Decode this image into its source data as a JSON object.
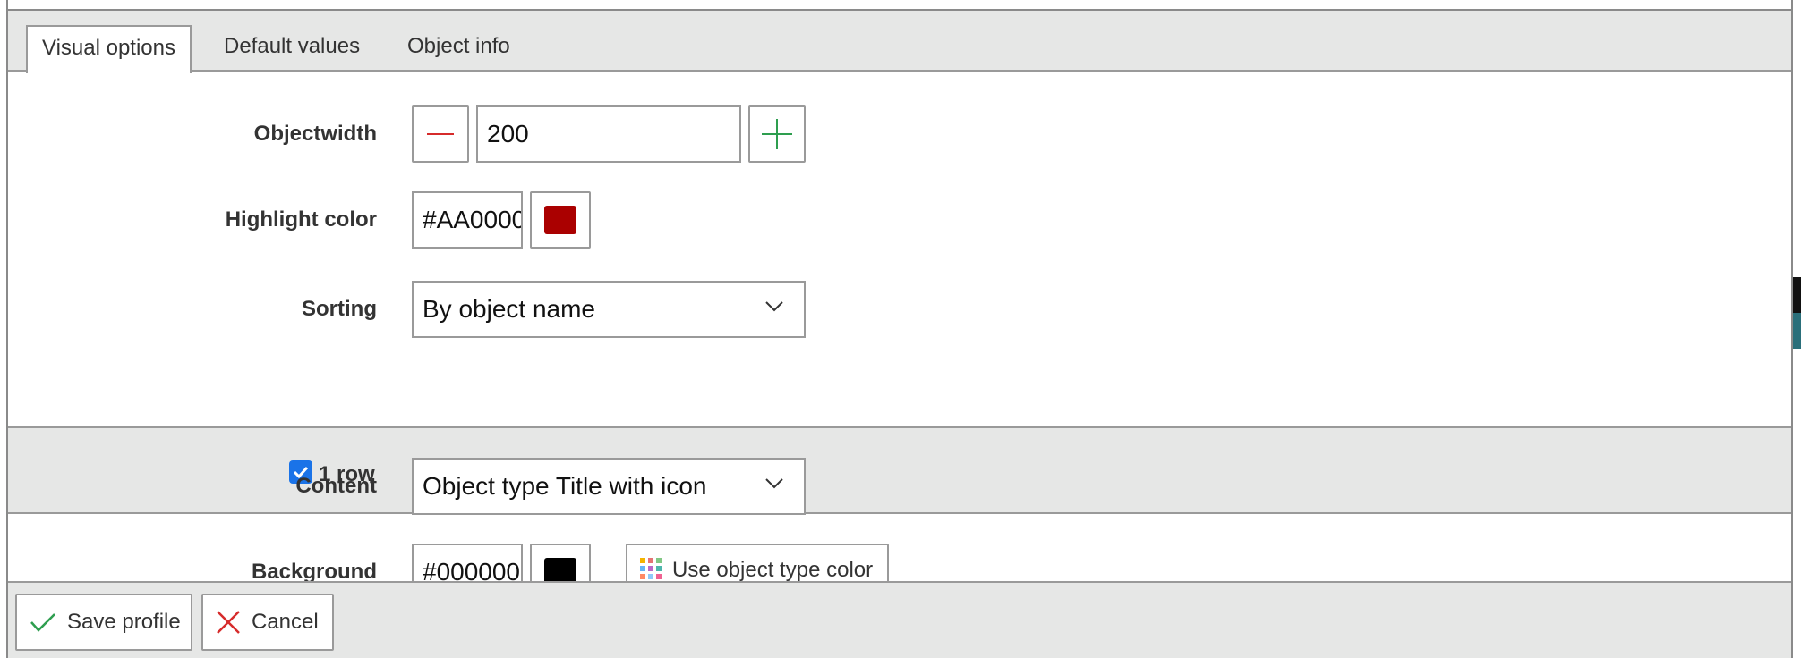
{
  "tabs": [
    {
      "label": "Visual options",
      "active": true
    },
    {
      "label": "Default values",
      "active": false
    },
    {
      "label": "Object info",
      "active": false
    }
  ],
  "objectwidth": {
    "label": "Objectwidth",
    "value": "200",
    "minus_icon": "minus-icon",
    "plus_icon": "plus-icon"
  },
  "highlight_color": {
    "label": "Highlight color",
    "value": "#AA0000",
    "swatch": "#AA0000"
  },
  "sorting": {
    "label": "Sorting",
    "selected": "By object name"
  },
  "one_row": {
    "label": "1 row",
    "checked": true
  },
  "content": {
    "label": "Content",
    "selected": "Object type Title with icon"
  },
  "background": {
    "label": "Background",
    "value": "#000000",
    "swatch": "#000000",
    "use_type_color_label": "Use object type color"
  },
  "footer": {
    "save_label": "Save profile",
    "cancel_label": "Cancel"
  },
  "colors": {
    "accent_green": "#2e9e4f",
    "accent_red": "#d62b2b",
    "checkbox_blue": "#1a73e8",
    "panel_gray": "#e6e7e6"
  }
}
